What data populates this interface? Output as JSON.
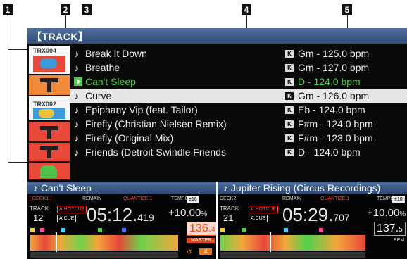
{
  "callouts": [
    "1",
    "2",
    "3",
    "4",
    "5"
  ],
  "browser": {
    "title": "【TRACK】",
    "rows": [
      {
        "title": "Break It Down",
        "key": "Gm - 125.0 bpm",
        "state": "normal"
      },
      {
        "title": "Breathe",
        "key": "Gm - 127.0 bpm",
        "state": "normal"
      },
      {
        "title": "Can't Sleep",
        "key": "D - 124.0 bpm",
        "state": "playing"
      },
      {
        "title": "Curve",
        "key": "Gm - 126.0 bpm",
        "state": "selected"
      },
      {
        "title": "Epiphany Vip (feat. Tailor)",
        "key": "Eb - 124.0 bpm",
        "state": "normal"
      },
      {
        "title": "Firefly (Christian Nielsen Remix)",
        "key": "F#m - 124.0 bpm",
        "state": "normal"
      },
      {
        "title": "Firefly (Original Mix)",
        "key": "F#m - 123.0 bpm",
        "state": "normal"
      },
      {
        "title": "Friends (Detroit Swindle Friends",
        "key": "D - 124.0 bpm",
        "state": "normal"
      }
    ],
    "art_labels": [
      "TRX004",
      "TRX002"
    ],
    "note_glyph": "♪",
    "key_icon": "K"
  },
  "deck1": {
    "title": "♪ Can't Sleep",
    "deck_label": "[ DECK1 ]",
    "remain": "REMAIN",
    "quantize": "QUANTIZE:1",
    "tempo_label": "TEMPO",
    "tempo_range": "±16",
    "track_label": "TRACK",
    "track_num": "12",
    "hotcue": "A.HOTCUE",
    "acue": "A.CUE",
    "time_main": "05:12.",
    "time_ms": "419",
    "tempo_pct": "+10.00",
    "pct_sign": "%",
    "bpm_main": "136.",
    "bpm_dec": "4",
    "master": "MASTER",
    "loop_num": "4"
  },
  "deck2": {
    "title": "♪ Jupiter Rising (Circus Recordings)",
    "deck_label": "DECK2",
    "remain": "REMAIN",
    "quantize": "QUANTIZE:1",
    "tempo_label": "TEMPO",
    "tempo_range": "±10",
    "track_label": "TRACK",
    "track_num": "21",
    "hotcue": "A.HOTCUE",
    "acue": "A.CUE",
    "time_main": "05:29.",
    "time_ms": "707",
    "tempo_pct": "+10.00",
    "pct_sign": "%",
    "bpm_main": "137.",
    "bpm_dec": "5",
    "bpm_unit": "BPM"
  }
}
